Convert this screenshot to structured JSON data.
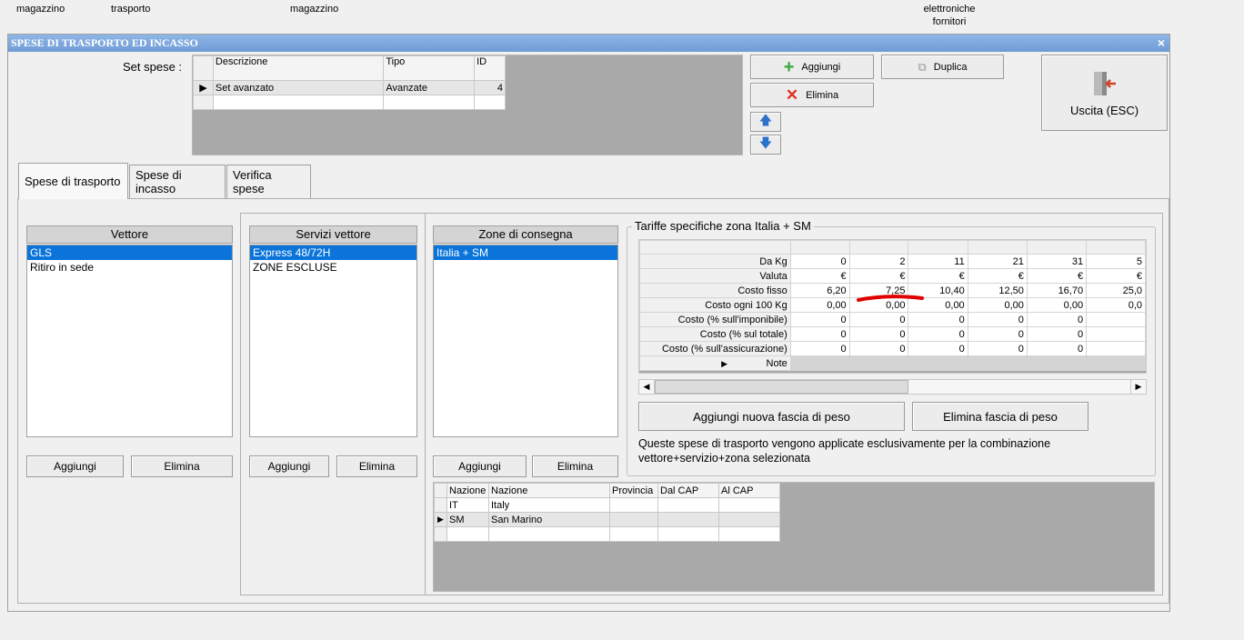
{
  "background_labels": [
    "magazzino",
    "trasporto",
    "magazzino",
    "elettroniche",
    "fornitori"
  ],
  "window": {
    "title": "SPESE DI TRASPORTO ED INCASSO",
    "close": "×"
  },
  "set_spese": {
    "label": "Set spese :",
    "columns": [
      "Descrizione",
      "Tipo",
      "ID"
    ],
    "rows": [
      {
        "descrizione": "Set avanzato",
        "tipo": "Avanzate",
        "id": "4"
      }
    ]
  },
  "buttons": {
    "add": "Aggiungi",
    "duplicate": "Duplica",
    "delete": "Elimina",
    "exit": "Uscita (ESC)"
  },
  "tabs": [
    "Spese di trasporto",
    "Spese di incasso",
    "Verifica spese"
  ],
  "vettore": {
    "header": "Vettore",
    "items": [
      "GLS",
      "Ritiro in sede"
    ],
    "add": "Aggiungi",
    "delete": "Elimina"
  },
  "servizi": {
    "header": "Servizi vettore",
    "items": [
      "Express 48/72H",
      "ZONE ESCLUSE"
    ],
    "add": "Aggiungi",
    "delete": "Elimina"
  },
  "zone": {
    "header": "Zone di consegna",
    "items": [
      "Italia + SM"
    ],
    "add": "Aggiungi",
    "delete": "Elimina"
  },
  "nazioni": {
    "columns": [
      "Nazione",
      "Nazione",
      "Provincia",
      "Dal CAP",
      "Al CAP"
    ],
    "rows": [
      [
        "IT",
        "Italy",
        "",
        "",
        ""
      ],
      [
        "SM",
        "San Marino",
        "",
        "",
        ""
      ]
    ]
  },
  "tariffe": {
    "title": "Tariffe specifiche zona Italia + SM",
    "row_labels": [
      "Da Kg",
      "Valuta",
      "Costo fisso",
      "Costo ogni 100 Kg",
      "Costo (% sull'imponibile)",
      "Costo (% sul totale)",
      "Costo (% sull'assicurazione)",
      "Note"
    ],
    "columns": [
      [
        "0",
        "€",
        "6,20",
        "0,00",
        "0",
        "0",
        "0",
        ""
      ],
      [
        "2",
        "€",
        "7,25",
        "0,00",
        "0",
        "0",
        "0",
        ""
      ],
      [
        "11",
        "€",
        "10,40",
        "0,00",
        "0",
        "0",
        "0",
        ""
      ],
      [
        "21",
        "€",
        "12,50",
        "0,00",
        "0",
        "0",
        "0",
        ""
      ],
      [
        "31",
        "€",
        "16,70",
        "0,00",
        "0",
        "0",
        "0",
        ""
      ],
      [
        "5",
        "€",
        "25,0",
        "0,0",
        "",
        "",
        "",
        ""
      ]
    ],
    "add_band": "Aggiungi nuova fascia di peso",
    "delete_band": "Elimina fascia di peso",
    "info": "Queste spese di trasporto vengono applicate esclusivamente per la combinazione vettore+servizio+zona selezionata"
  },
  "colors": {
    "title_bar": "#7aa6dd",
    "selection": "#0a74da",
    "annotation": "#e00000"
  }
}
